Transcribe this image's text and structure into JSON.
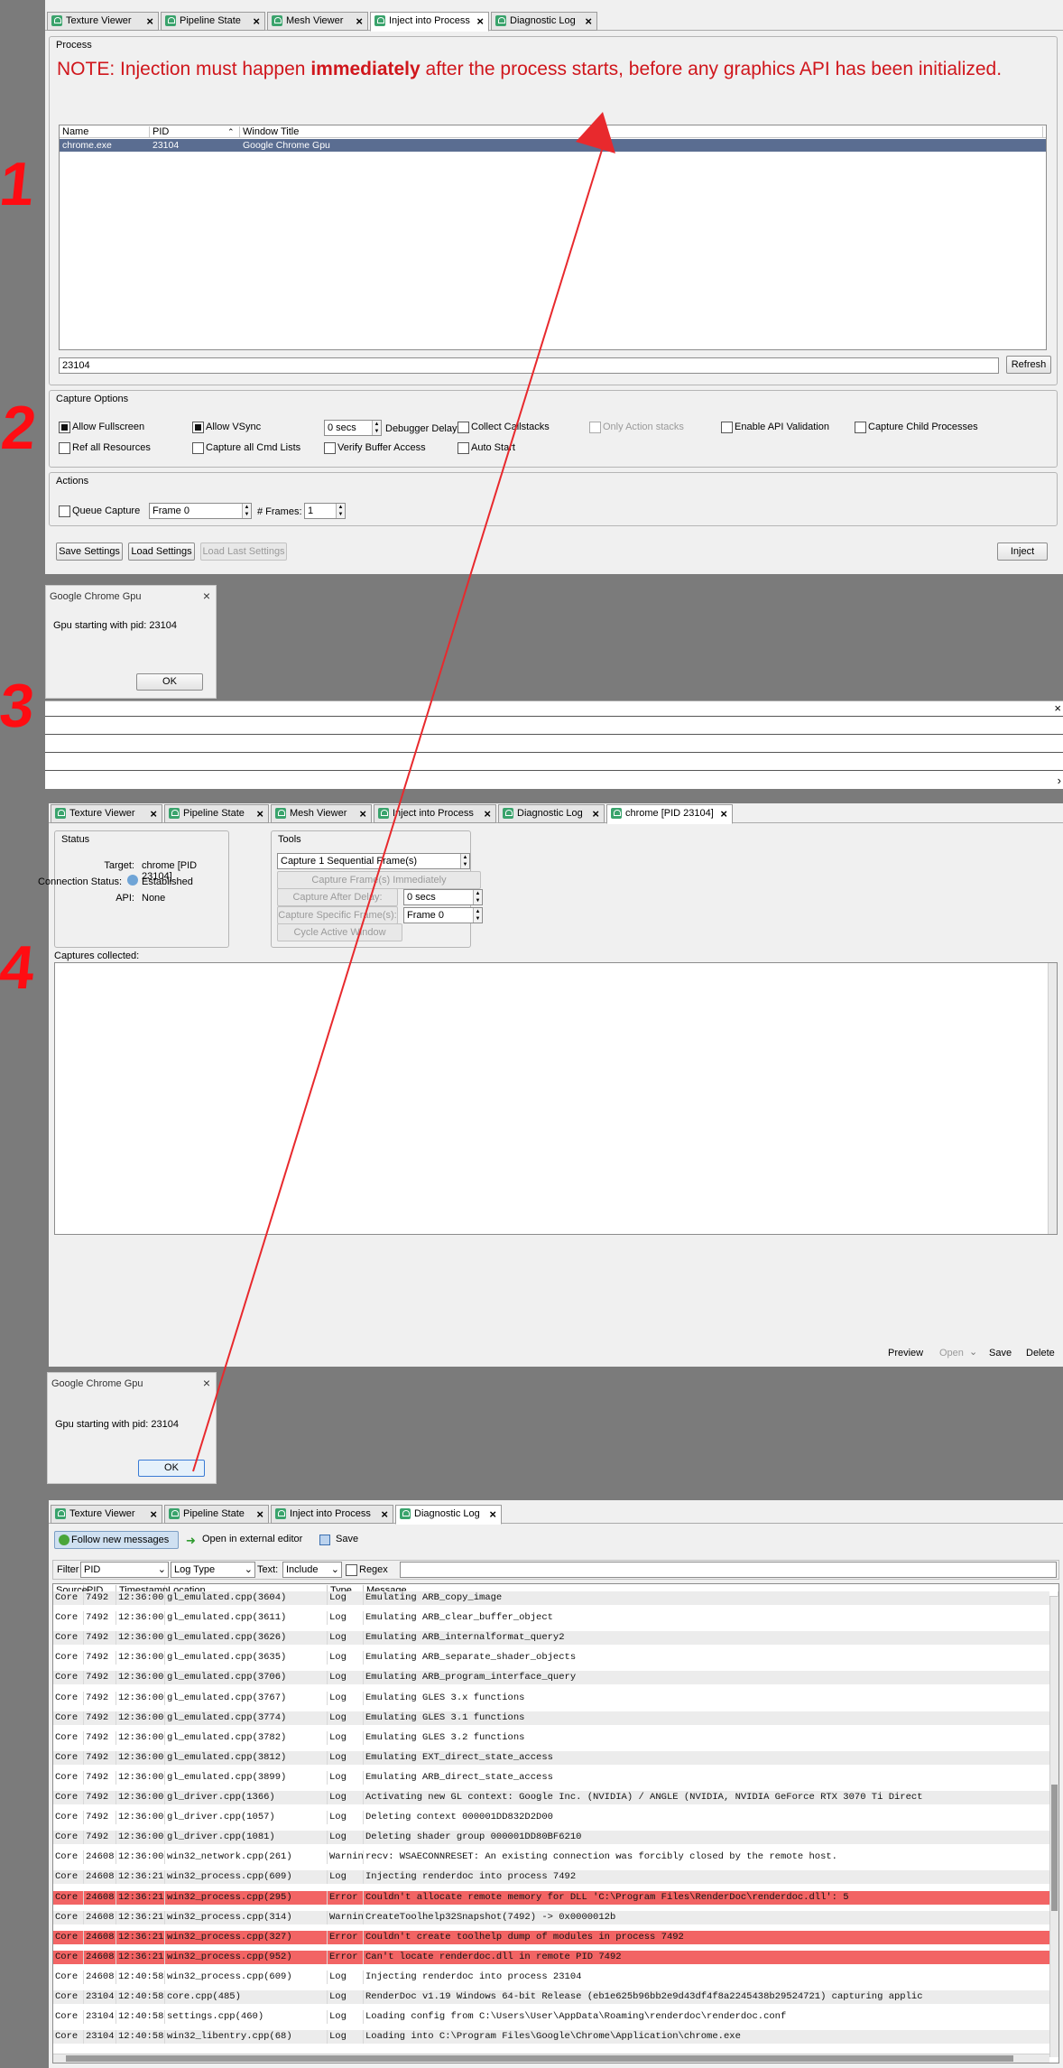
{
  "annotations": {
    "step1": "1",
    "step2": "2",
    "step3": "3",
    "step4": "4"
  },
  "panel1": {
    "tabs": [
      "Texture Viewer",
      "Pipeline State",
      "Mesh Viewer",
      "Inject into Process",
      "Diagnostic Log"
    ],
    "process_group": "Process",
    "note_prefix": "NOTE: Injection must happen ",
    "note_bold": "immediately",
    "note_suffix": " after the process starts, before any graphics API has been initialized.",
    "columns": [
      "Name",
      "PID",
      "Window Title"
    ],
    "rows": [
      {
        "name": "chrome.exe",
        "pid": "23104",
        "title": "Google Chrome Gpu"
      }
    ],
    "pid_value": "23104",
    "refresh": "Refresh",
    "capture_options": "Capture Options",
    "opts": {
      "allow_fullscreen": "Allow Fullscreen",
      "allow_vsync": "Allow VSync",
      "delay_value": "0 secs",
      "debugger_delay": "Debugger Delay",
      "collect_callstacks": "Collect Callstacks",
      "only_action_stacks": "Only Action stacks",
      "enable_api_validation": "Enable API Validation",
      "capture_child": "Capture Child Processes",
      "ref_all": "Ref all Resources",
      "capture_all_cmd": "Capture all Cmd Lists",
      "verify_buffer": "Verify Buffer Access",
      "auto_start": "Auto Start"
    },
    "actions": "Actions",
    "queue_capture": "Queue Capture",
    "frame_value": "Frame 0",
    "num_frames_label": "# Frames:",
    "num_frames_value": "1",
    "save_settings": "Save Settings",
    "load_settings": "Load Settings",
    "load_last": "Load Last Settings",
    "inject": "Inject"
  },
  "dialog1": {
    "title": "Google Chrome Gpu",
    "message": "Gpu starting with pid: 23104",
    "ok": "OK"
  },
  "panel3": {
    "tabs": [
      "Texture Viewer",
      "Pipeline State",
      "Mesh Viewer",
      "Inject into Process",
      "Diagnostic Log",
      "chrome [PID 23104]"
    ],
    "status": "Status",
    "target_label": "Target:",
    "target_value": "chrome [PID 23104]",
    "conn_label": "Connection Status:",
    "conn_value": "Established",
    "api_label": "API:",
    "api_value": "None",
    "tools": "Tools",
    "capture_seq": "Capture 1 Sequential Frame(s)",
    "capture_immediately": "Capture Frame(s) Immediately",
    "capture_after_delay": "Capture After Delay:",
    "delay_value": "0 secs",
    "capture_specific": "Capture Specific Frame(s):",
    "frame_value": "Frame 0",
    "cycle_window": "Cycle Active Window",
    "captures_collected": "Captures collected:",
    "footer": {
      "preview": "Preview",
      "open": "Open",
      "save": "Save",
      "delete": "Delete"
    }
  },
  "dialog2": {
    "title": "Google Chrome Gpu",
    "message": "Gpu starting with pid: 23104",
    "ok": "OK"
  },
  "panel4": {
    "tabs": [
      "Texture Viewer",
      "Pipeline State",
      "Inject into Process",
      "Diagnostic Log"
    ],
    "follow": "Follow new messages",
    "open_editor": "Open in external editor",
    "save": "Save",
    "filter": "Filter",
    "filter_field": "PID",
    "log_type": "Log Type",
    "text_label": "Text:",
    "include": "Include",
    "regex": "Regex",
    "columns": [
      "Source",
      "PID",
      "Timestamp",
      "Location",
      "Type",
      "Message"
    ],
    "rows": [
      [
        "Core",
        "7492",
        "12:36:00",
        "gl_emulated.cpp(3604)",
        "Log",
        "Emulating ARB_copy_image"
      ],
      [
        "Core",
        "7492",
        "12:36:00",
        "gl_emulated.cpp(3611)",
        "Log",
        "Emulating ARB_clear_buffer_object"
      ],
      [
        "Core",
        "7492",
        "12:36:00",
        "gl_emulated.cpp(3626)",
        "Log",
        "Emulating ARB_internalformat_query2"
      ],
      [
        "Core",
        "7492",
        "12:36:00",
        "gl_emulated.cpp(3635)",
        "Log",
        "Emulating ARB_separate_shader_objects"
      ],
      [
        "Core",
        "7492",
        "12:36:00",
        "gl_emulated.cpp(3706)",
        "Log",
        "Emulating ARB_program_interface_query"
      ],
      [
        "Core",
        "7492",
        "12:36:00",
        "gl_emulated.cpp(3767)",
        "Log",
        "Emulating GLES 3.x functions"
      ],
      [
        "Core",
        "7492",
        "12:36:00",
        "gl_emulated.cpp(3774)",
        "Log",
        "Emulating GLES 3.1 functions"
      ],
      [
        "Core",
        "7492",
        "12:36:00",
        "gl_emulated.cpp(3782)",
        "Log",
        "Emulating GLES 3.2 functions"
      ],
      [
        "Core",
        "7492",
        "12:36:00",
        "gl_emulated.cpp(3812)",
        "Log",
        "Emulating EXT_direct_state_access"
      ],
      [
        "Core",
        "7492",
        "12:36:00",
        "gl_emulated.cpp(3899)",
        "Log",
        "Emulating ARB_direct_state_access"
      ],
      [
        "Core",
        "7492",
        "12:36:00",
        "gl_driver.cpp(1366)",
        "Log",
        "Activating new GL context: Google Inc. (NVIDIA) / ANGLE (NVIDIA, NVIDIA GeForce RTX 3070 Ti Direct"
      ],
      [
        "Core",
        "7492",
        "12:36:00",
        "gl_driver.cpp(1057)",
        "Log",
        "Deleting context 000001DD832D2D00"
      ],
      [
        "Core",
        "7492",
        "12:36:00",
        "gl_driver.cpp(1081)",
        "Log",
        "Deleting shader group 000001DD80BF6210"
      ],
      [
        "Core",
        "24608",
        "12:36:00",
        "win32_network.cpp(261)",
        "Warning",
        "recv: WSAECONNRESET: An existing connection was forcibly closed by the remote host."
      ],
      [
        "Core",
        "24608",
        "12:36:21",
        "win32_process.cpp(609)",
        "Log",
        "Injecting renderdoc into process 7492"
      ],
      [
        "Core",
        "24608",
        "12:36:21",
        "win32_process.cpp(295)",
        "Error",
        "Couldn't allocate remote memory for DLL 'C:\\Program Files\\RenderDoc\\renderdoc.dll': 5"
      ],
      [
        "Core",
        "24608",
        "12:36:21",
        "win32_process.cpp(314)",
        "Warning",
        "CreateToolhelp32Snapshot(7492) -> 0x0000012b"
      ],
      [
        "Core",
        "24608",
        "12:36:21",
        "win32_process.cpp(327)",
        "Error",
        "Couldn't create toolhelp dump of modules in process 7492"
      ],
      [
        "Core",
        "24608",
        "12:36:21",
        "win32_process.cpp(952)",
        "Error",
        "Can't locate renderdoc.dll in remote PID 7492"
      ],
      [
        "Core",
        "24608",
        "12:40:58",
        "win32_process.cpp(609)",
        "Log",
        "Injecting renderdoc into process 23104"
      ],
      [
        "Core",
        "23104",
        "12:40:58",
        "core.cpp(485)",
        "Log",
        "RenderDoc v1.19 Windows 64-bit Release (eb1e625b96bb2e9d43df4f8a2245438b29524721) capturing applic"
      ],
      [
        "Core",
        "23104",
        "12:40:58",
        "settings.cpp(460)",
        "Log",
        "Loading config from C:\\Users\\User\\AppData\\Roaming\\renderdoc\\renderdoc.conf"
      ],
      [
        "Core",
        "23104",
        "12:40:58",
        "win32_libentry.cpp(68)",
        "Log",
        "Loading into C:\\Program Files\\Google\\Chrome\\Application\\chrome.exe"
      ]
    ]
  },
  "colors": {
    "accent_red": "#ff0c12",
    "note_red": "#d0161c",
    "error_row": "#f26464",
    "selection": "#5a6d91"
  }
}
